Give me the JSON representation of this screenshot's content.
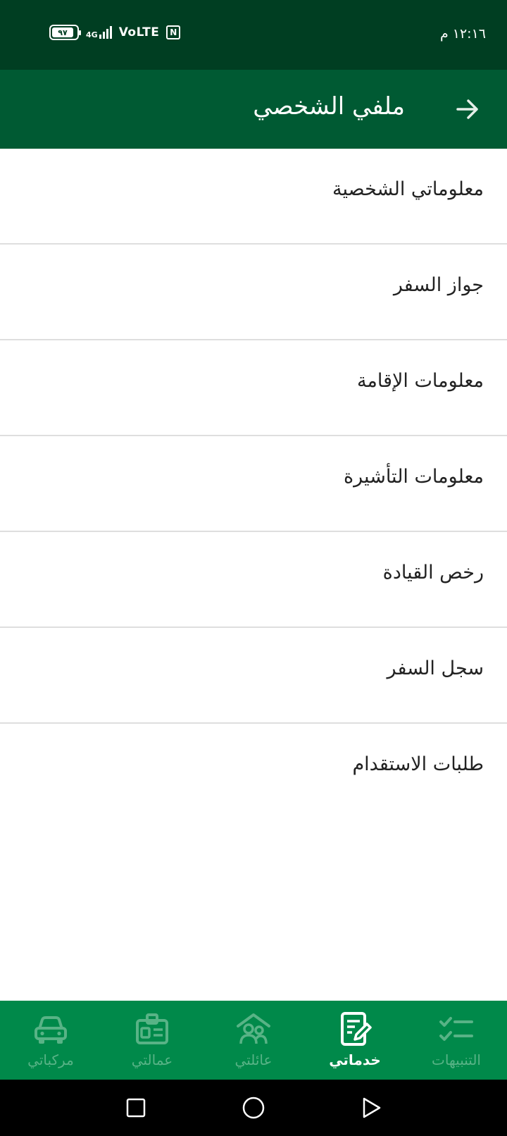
{
  "status_bar": {
    "time": "١٢:١٦ م",
    "battery_level": "٩٧",
    "network": "4G",
    "volte": "VoLTE",
    "nfc": "N"
  },
  "app_bar": {
    "title": "ملفي الشخصي",
    "back_icon": "arrow-right-icon"
  },
  "menu": {
    "items": [
      {
        "label": "معلوماتي الشخصية"
      },
      {
        "label": "جواز السفر"
      },
      {
        "label": "معلومات الإقامة"
      },
      {
        "label": "معلومات التأشيرة"
      },
      {
        "label": "رخص القيادة"
      },
      {
        "label": "سجل السفر"
      },
      {
        "label": "طلبات الاستقدام"
      }
    ]
  },
  "bottom_nav": {
    "items": [
      {
        "label": "التنبيهات",
        "icon": "checklist-icon",
        "active": false
      },
      {
        "label": "خدماتي",
        "icon": "edit-document-icon",
        "active": true
      },
      {
        "label": "عائلتي",
        "icon": "family-icon",
        "active": false
      },
      {
        "label": "عمالتي",
        "icon": "id-card-icon",
        "active": false
      },
      {
        "label": "مركباتي",
        "icon": "car-icon",
        "active": false
      }
    ]
  },
  "colors": {
    "status_bar": "#003e22",
    "app_bar": "#005a33",
    "bottom_nav": "#00894a",
    "nav_inactive": "#58b386",
    "nav_active": "#ffffff"
  }
}
